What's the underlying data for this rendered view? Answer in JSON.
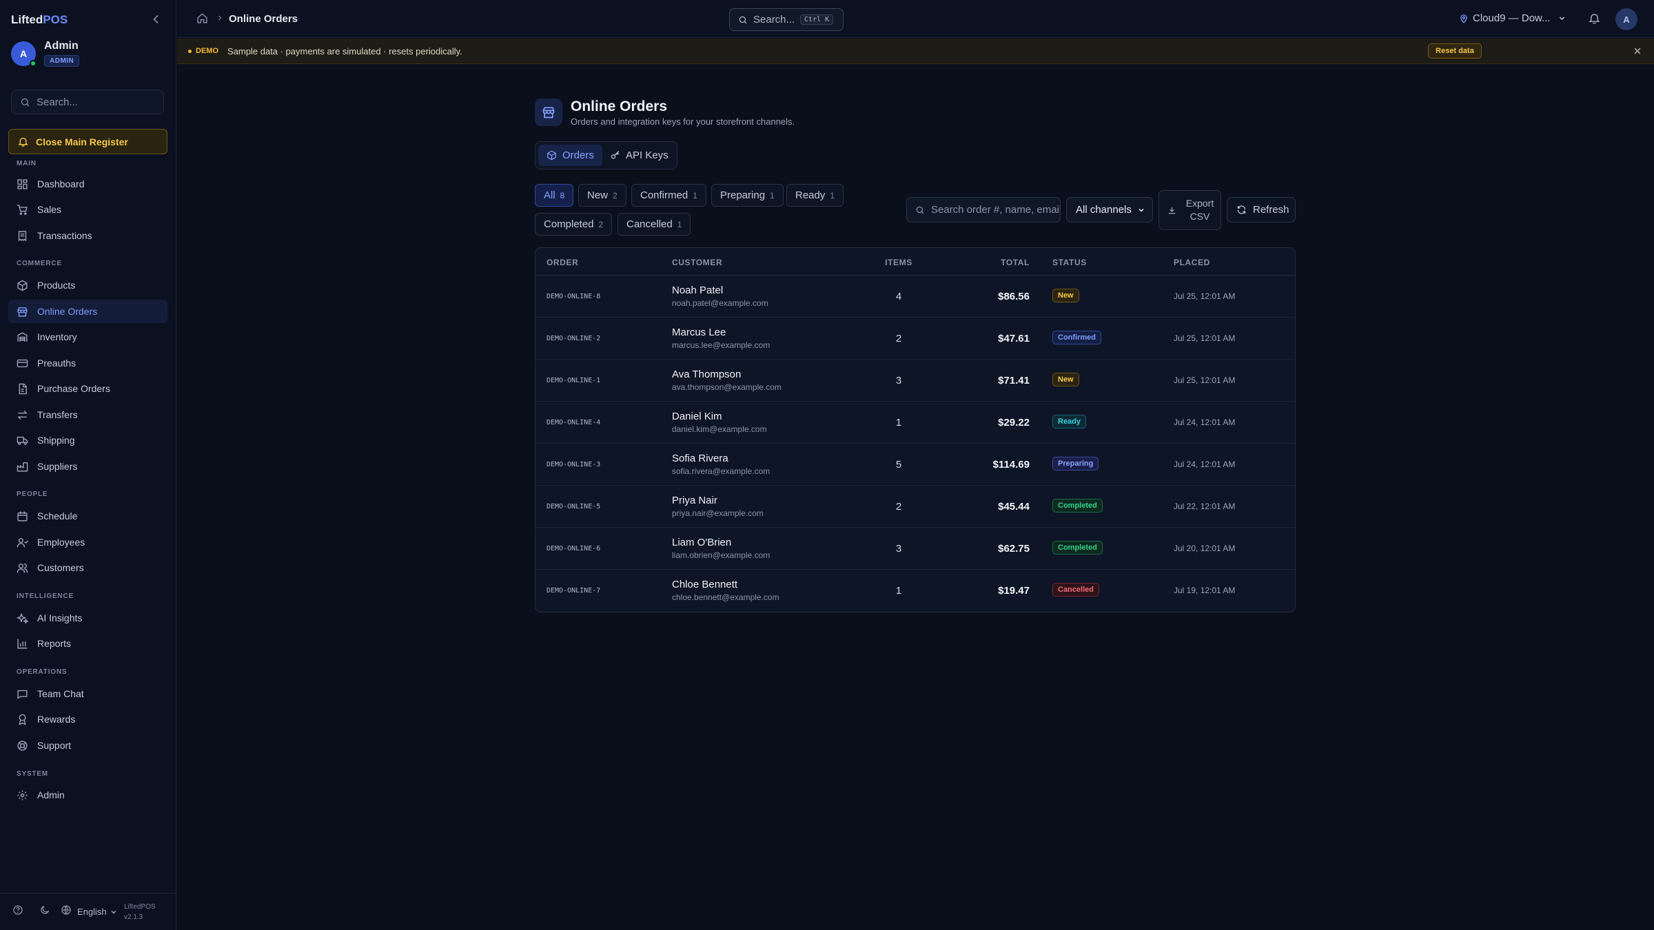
{
  "sidebar": {
    "brand_main": "Lifted",
    "brand_accent": "POS",
    "user": {
      "initial": "A",
      "name": "Admin",
      "role": "ADMIN"
    },
    "search_placeholder": "Search...",
    "register_button": "Close Main Register",
    "sections": {
      "main": "MAIN",
      "commerce": "COMMERCE",
      "people": "PEOPLE",
      "intelligence": "INTELLIGENCE",
      "operations": "OPERATIONS",
      "system": "SYSTEM"
    },
    "items": {
      "dashboard": "Dashboard",
      "sales": "Sales",
      "transactions": "Transactions",
      "products": "Products",
      "online_orders": "Online Orders",
      "inventory": "Inventory",
      "preauths": "Preauths",
      "purchase_orders": "Purchase Orders",
      "transfers": "Transfers",
      "shipping": "Shipping",
      "suppliers": "Suppliers",
      "schedule": "Schedule",
      "employees": "Employees",
      "customers": "Customers",
      "ai_insights": "AI Insights",
      "reports": "Reports",
      "team_chat": "Team Chat",
      "rewards": "Rewards",
      "support": "Support",
      "admin": "Admin"
    },
    "footer": {
      "language": "English",
      "app_name": "LiftedPOS",
      "version": "v2.1.3"
    }
  },
  "topbar": {
    "breadcrumb_current": "Online Orders",
    "search_label": "Search...",
    "search_shortcut": "Ctrl K",
    "location": "Cloud9 — Dow...",
    "avatar_initial": "A"
  },
  "banner": {
    "tag": "DEMO",
    "text": "Sample data · payments are simulated · resets periodically.",
    "reset_label": "Reset data"
  },
  "page": {
    "title": "Online Orders",
    "subtitle": "Orders and integration keys for your storefront channels.",
    "tabs": {
      "orders": "Orders",
      "api_keys": "API Keys"
    }
  },
  "filters": [
    {
      "label": "All",
      "count": "8"
    },
    {
      "label": "New",
      "count": "2"
    },
    {
      "label": "Confirmed",
      "count": "1"
    },
    {
      "label": "Preparing",
      "count": "1"
    },
    {
      "label": "Ready",
      "count": "1"
    },
    {
      "label": "Completed",
      "count": "2"
    },
    {
      "label": "Cancelled",
      "count": "1"
    }
  ],
  "toolbar": {
    "search_placeholder": "Search order #, name, email",
    "channel_select": "All channels",
    "export_line1": "Export",
    "export_line2": "CSV",
    "refresh": "Refresh"
  },
  "table": {
    "headers": {
      "order": "ORDER",
      "customer": "CUSTOMER",
      "items": "ITEMS",
      "total": "TOTAL",
      "status": "STATUS",
      "placed": "PLACED"
    },
    "rows": [
      {
        "order": "DEMO-ONLINE-8",
        "name": "Noah Patel",
        "email": "noah.patel@example.com",
        "items": "4",
        "total": "$86.56",
        "status": "New",
        "placed": "Jul 25, 12:01 AM"
      },
      {
        "order": "DEMO-ONLINE-2",
        "name": "Marcus Lee",
        "email": "marcus.lee@example.com",
        "items": "2",
        "total": "$47.61",
        "status": "Confirmed",
        "placed": "Jul 25, 12:01 AM"
      },
      {
        "order": "DEMO-ONLINE-1",
        "name": "Ava Thompson",
        "email": "ava.thompson@example.com",
        "items": "3",
        "total": "$71.41",
        "status": "New",
        "placed": "Jul 25, 12:01 AM"
      },
      {
        "order": "DEMO-ONLINE-4",
        "name": "Daniel Kim",
        "email": "daniel.kim@example.com",
        "items": "1",
        "total": "$29.22",
        "status": "Ready",
        "placed": "Jul 24, 12:01 AM"
      },
      {
        "order": "DEMO-ONLINE-3",
        "name": "Sofia Rivera",
        "email": "sofia.rivera@example.com",
        "items": "5",
        "total": "$114.69",
        "status": "Preparing",
        "placed": "Jul 24, 12:01 AM"
      },
      {
        "order": "DEMO-ONLINE-5",
        "name": "Priya Nair",
        "email": "priya.nair@example.com",
        "items": "2",
        "total": "$45.44",
        "status": "Completed",
        "placed": "Jul 22, 12:01 AM"
      },
      {
        "order": "DEMO-ONLINE-6",
        "name": "Liam O'Brien",
        "email": "liam.obrien@example.com",
        "items": "3",
        "total": "$62.75",
        "status": "Completed",
        "placed": "Jul 20, 12:01 AM"
      },
      {
        "order": "DEMO-ONLINE-7",
        "name": "Chloe Bennett",
        "email": "chloe.bennett@example.com",
        "items": "1",
        "total": "$19.47",
        "status": "Cancelled",
        "placed": "Jul 19, 12:01 AM"
      }
    ]
  },
  "colors": {
    "background": "#0a0f1c",
    "accent": "#7d9bff",
    "status_new": "#f5c84c",
    "status_confirmed": "#7f9cff",
    "status_ready": "#38d0e6",
    "status_preparing": "#8aa2ff",
    "status_completed": "#37d28a",
    "status_cancelled": "#f26b7a"
  }
}
